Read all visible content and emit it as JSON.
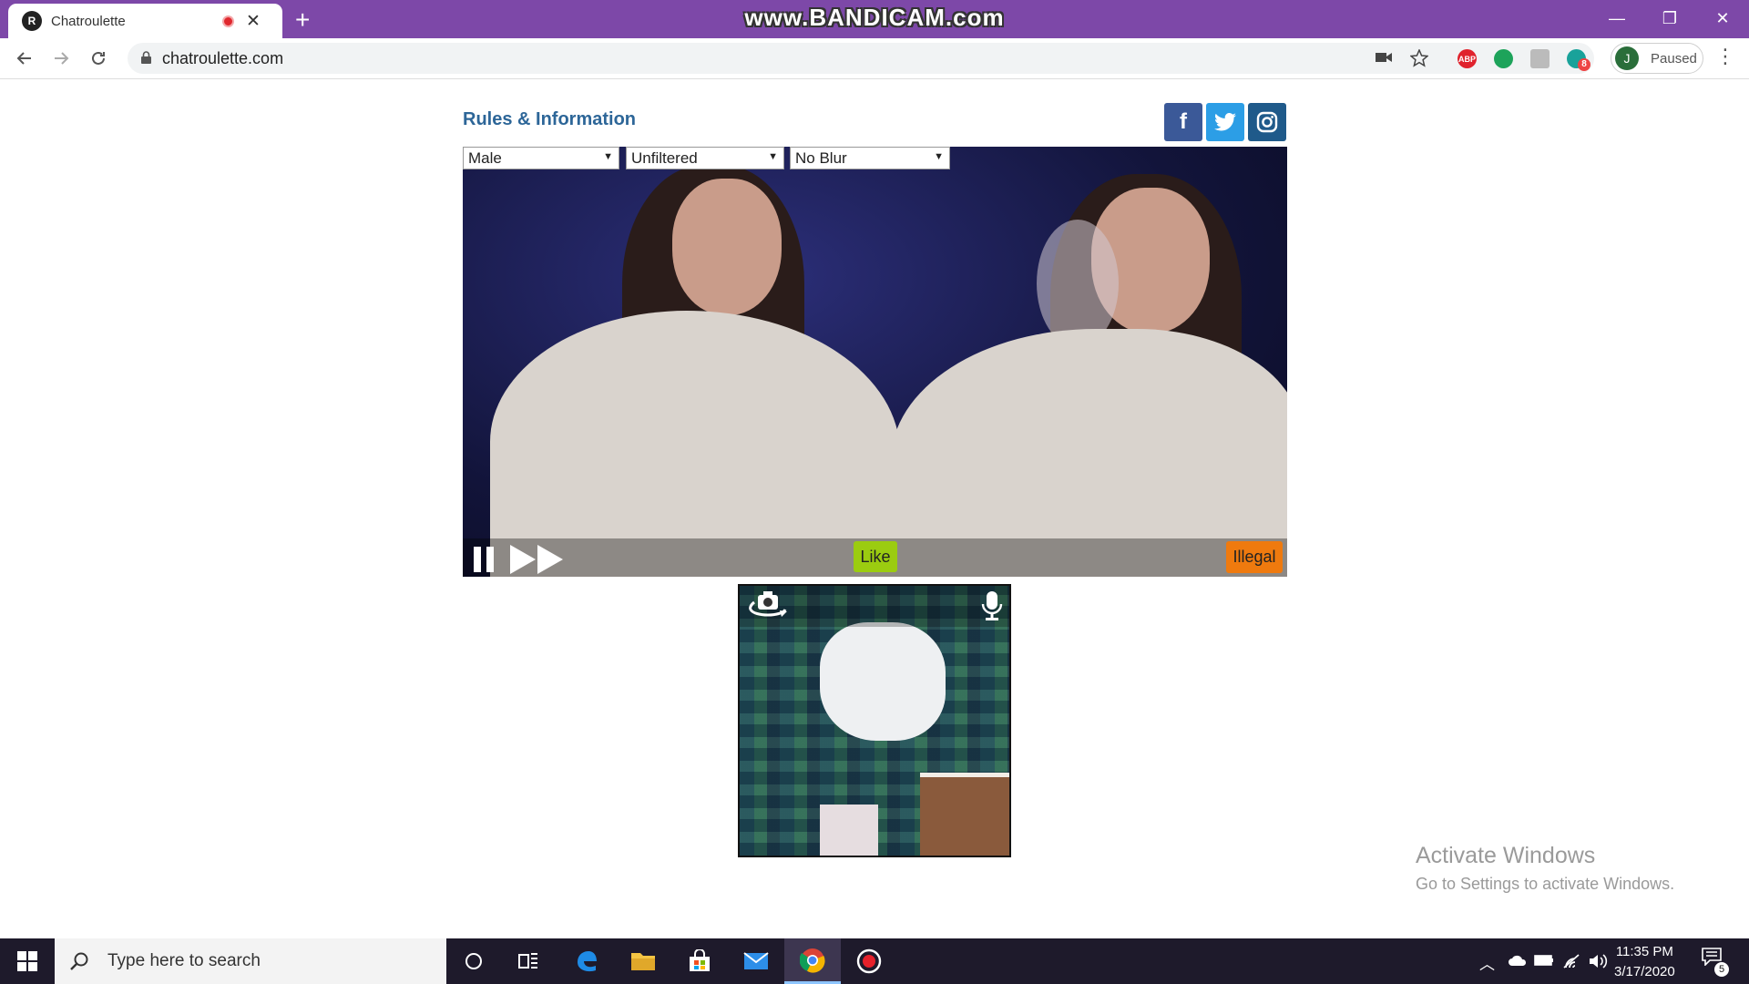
{
  "browser": {
    "tab_title": "Chatroulette",
    "favicon_text": "R",
    "watermark": "www.BANDICAM.com",
    "new_tab": "+",
    "close_tab": "✕",
    "win_min": "—",
    "win_restore": "❐",
    "win_close": "✕",
    "url": "chatroulette.com",
    "profile_initial": "J",
    "profile_status": "Paused",
    "ext_abp": "ABP",
    "ext_badge": "8",
    "accent_tabstrip": "#7d48a8"
  },
  "page": {
    "title": "Rules & Information",
    "social": {
      "facebook": "f",
      "twitter_icon": "twitter-icon",
      "instagram_icon": "instagram-icon"
    },
    "filters": [
      {
        "value": "Male"
      },
      {
        "value": "Unfiltered"
      },
      {
        "value": "No Blur"
      }
    ],
    "controls": {
      "like": "Like",
      "illegal": "Illegal"
    },
    "colors": {
      "like": "#9bcc10",
      "illegal": "#ef7a0e",
      "title": "#2d6698"
    }
  },
  "windows": {
    "activate_title": "Activate Windows",
    "activate_sub": "Go to Settings to activate Windows."
  },
  "taskbar": {
    "search_placeholder": "Type here to search",
    "time": "11:35 PM",
    "date": "3/17/2020",
    "notifications": "5"
  }
}
